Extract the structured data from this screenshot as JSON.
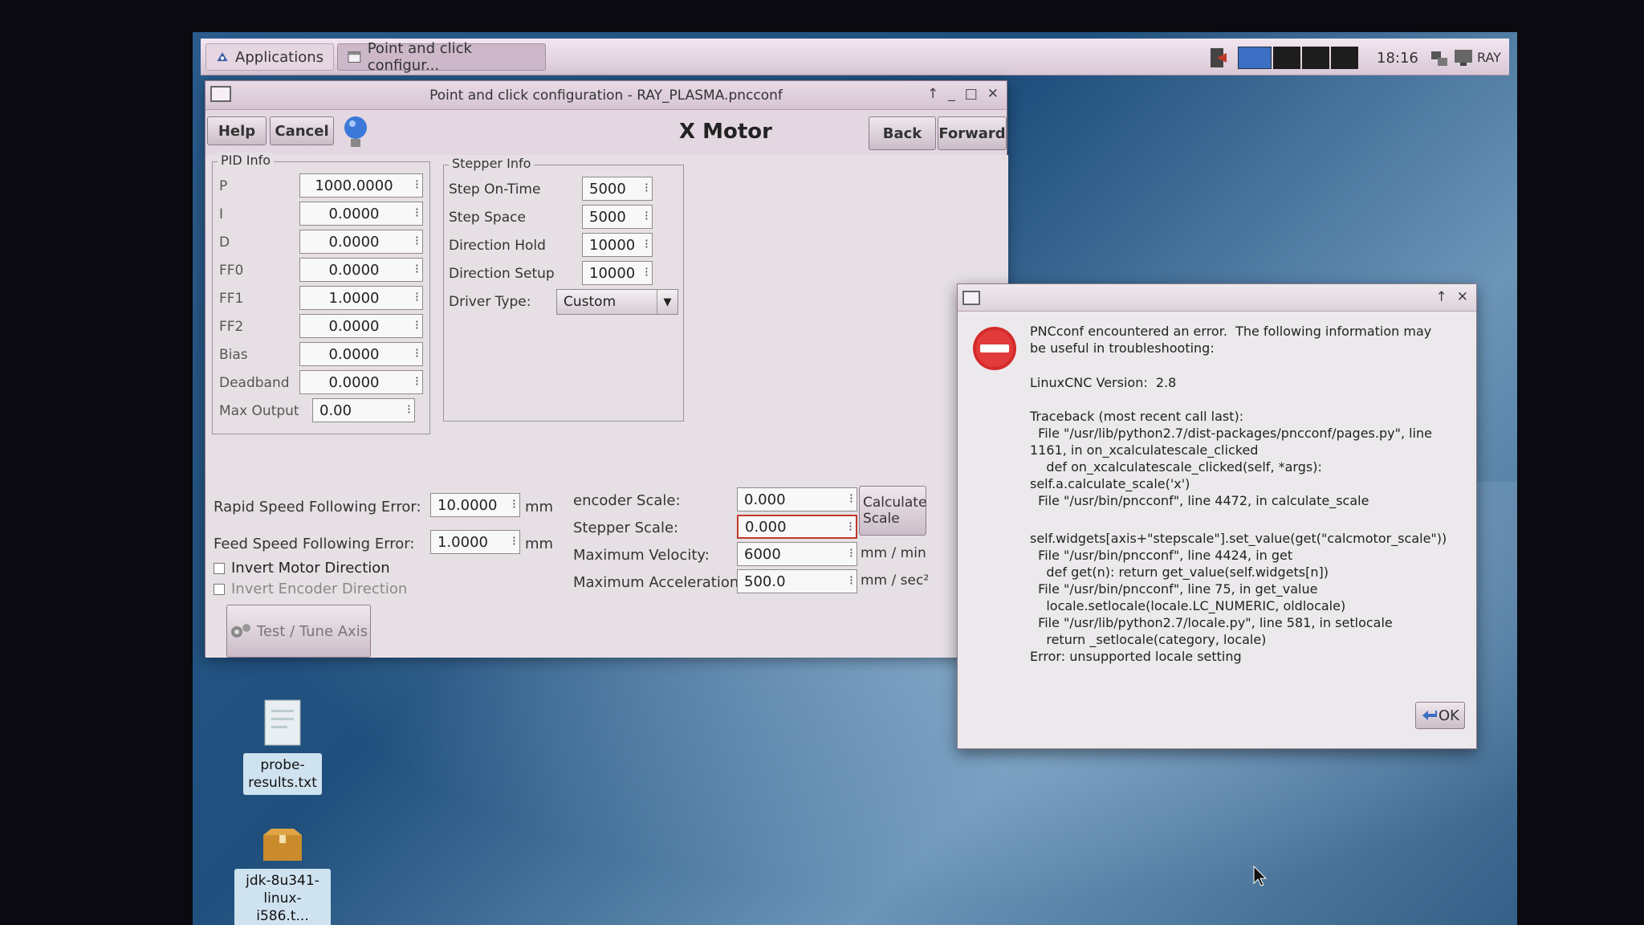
{
  "panel": {
    "applications_label": "Applications",
    "task_label": "Point and click configur...",
    "clock": "18:16",
    "user": "RAY"
  },
  "main_window": {
    "title": "Point and click configuration - RAY_PLASMA.pncconf",
    "help_label": "Help",
    "cancel_label": "Cancel",
    "heading": "X Motor",
    "back_label": "Back",
    "forward_label": "Forward",
    "pid": {
      "title": "PID Info",
      "rows": [
        {
          "label": "P",
          "value": "1000.0000"
        },
        {
          "label": "I",
          "value": "0.0000"
        },
        {
          "label": "D",
          "value": "0.0000"
        },
        {
          "label": "FF0",
          "value": "0.0000"
        },
        {
          "label": "FF1",
          "value": "1.0000"
        },
        {
          "label": "FF2",
          "value": "0.0000"
        },
        {
          "label": "Bias",
          "value": "0.0000"
        },
        {
          "label": "Deadband",
          "value": "0.0000"
        }
      ],
      "max_output_label": "Max Output",
      "max_output_value": "0.00"
    },
    "stepper": {
      "title": "Stepper Info",
      "rows": [
        {
          "label": "Step On-Time",
          "value": "5000"
        },
        {
          "label": "Step Space",
          "value": "5000"
        },
        {
          "label": "Direction Hold",
          "value": "10000"
        },
        {
          "label": "Direction Setup",
          "value": "10000"
        }
      ],
      "driver_type_label": "Driver Type:",
      "driver_type_value": "Custom"
    },
    "following": {
      "rapid_label": "Rapid Speed Following Error:",
      "rapid_value": "10.0000",
      "feed_label": "Feed Speed Following Error:",
      "feed_value": "1.0000",
      "unit": "mm"
    },
    "scale": {
      "encoder_label": "encoder Scale:",
      "encoder_value": "0.000",
      "stepper_label": "Stepper Scale:",
      "stepper_value": "0.000",
      "max_vel_label": "Maximum Velocity:",
      "max_vel_value": "6000",
      "max_vel_unit": "mm / min",
      "max_acc_label": "Maximum Acceleration:",
      "max_acc_value": "500.0",
      "max_acc_unit": "mm / sec²",
      "calc_line1": "Calculate",
      "calc_line2": "Scale"
    },
    "invert_motor_label": "Invert Motor Direction",
    "invert_encoder_label": "Invert Encoder Direction",
    "test_tune_label": "Test / Tune Axis"
  },
  "desktop": {
    "icon1_label_l1": "probe-",
    "icon1_label_l2": "results.txt",
    "icon2_label_l1": "jdk-8u341-",
    "icon2_label_l2": "linux-i586.t..."
  },
  "error_dialog": {
    "intro": "PNCconf encountered an error.  The following information may\nbe useful in troubleshooting:",
    "version": "LinuxCNC Version:  2.8",
    "traceback": "Traceback (most recent call last):\n  File \"/usr/lib/python2.7/dist-packages/pncconf/pages.py\", line\n1161, in on_xcalculatescale_clicked\n    def on_xcalculatescale_clicked(self, *args):\nself.a.calculate_scale('x')\n  File \"/usr/bin/pncconf\", line 4472, in calculate_scale",
    "traceback2": "self.widgets[axis+\"stepscale\"].set_value(get(\"calcmotor_scale\"))\n  File \"/usr/bin/pncconf\", line 4424, in get\n    def get(n): return get_value(self.widgets[n])\n  File \"/usr/bin/pncconf\", line 75, in get_value\n    locale.setlocale(locale.LC_NUMERIC, oldlocale)\n  File \"/usr/lib/python2.7/locale.py\", line 581, in setlocale\n    return _setlocale(category, locale)\nError: unsupported locale setting",
    "ok_label": "OK"
  }
}
